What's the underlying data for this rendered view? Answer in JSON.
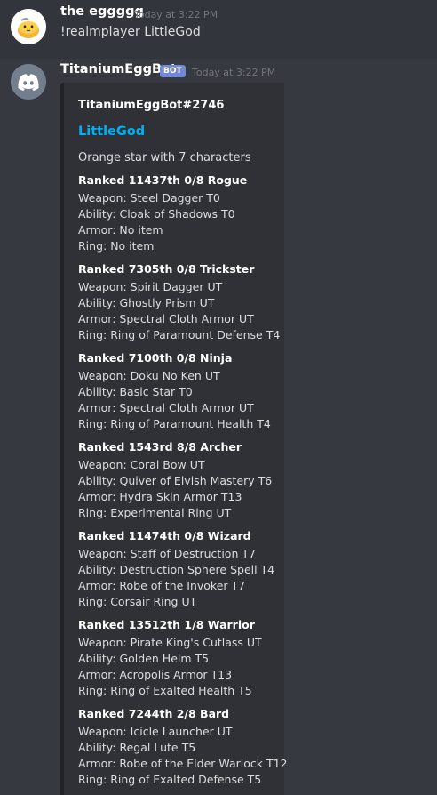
{
  "messages": [
    {
      "username": "the eggggg",
      "timestamp": "Today at 3:22 PM",
      "text": "!realmplayer LittleGod",
      "avatar": "egg-avatar-icon"
    },
    {
      "username": "TitaniumEggBot",
      "bot_tag": "BOT",
      "timestamp": "Today at 3:22 PM",
      "avatar": "discord-logo-icon"
    }
  ],
  "embed": {
    "author": "TitaniumEggBot#2746",
    "title": "LittleGod",
    "description": "Orange star with 7 characters",
    "fields": [
      {
        "name": "Ranked 11437th 0/8 Rogue",
        "lines": [
          "Weapon: Steel Dagger T0",
          "Ability: Cloak of Shadows T0",
          "Armor: No item",
          "Ring: No item"
        ]
      },
      {
        "name": "Ranked 7305th 0/8 Trickster",
        "lines": [
          "Weapon: Spirit Dagger UT",
          "Ability: Ghostly Prism UT",
          "Armor: Spectral Cloth Armor UT",
          "Ring: Ring of Paramount Defense T4"
        ]
      },
      {
        "name": "Ranked 7100th 0/8 Ninja",
        "lines": [
          "Weapon: Doku No Ken UT",
          "Ability: Basic Star T0",
          "Armor: Spectral Cloth Armor UT",
          "Ring: Ring of Paramount Health T4"
        ]
      },
      {
        "name": "Ranked 1543rd 8/8 Archer",
        "lines": [
          "Weapon: Coral Bow UT",
          "Ability: Quiver of Elvish Mastery T6",
          "Armor: Hydra Skin Armor T13",
          "Ring: Experimental Ring UT"
        ]
      },
      {
        "name": "Ranked 11474th 0/8 Wizard",
        "lines": [
          "Weapon: Staff of Destruction T7",
          "Ability: Destruction Sphere Spell T4",
          "Armor: Robe of the Invoker T7",
          "Ring: Corsair Ring UT"
        ]
      },
      {
        "name": "Ranked 13512th 1/8 Warrior",
        "lines": [
          "Weapon: Pirate King's Cutlass UT",
          "Ability: Golden Helm T5",
          "Armor: Acropolis Armor T13",
          "Ring: Ring of Exalted Health T5"
        ]
      },
      {
        "name": "Ranked 7244th 2/8 Bard",
        "lines": [
          "Weapon: Icicle Launcher UT",
          "Ability: Regal Lute T5",
          "Armor: Robe of the Elder Warlock T12",
          "Ring: Ring of Exalted Defense T5"
        ]
      }
    ]
  },
  "colors": {
    "background": "#36393f",
    "embed_background": "#2f3136",
    "embed_border": "#202225",
    "link": "#00b0f4",
    "bot_tag": "#7289da"
  }
}
